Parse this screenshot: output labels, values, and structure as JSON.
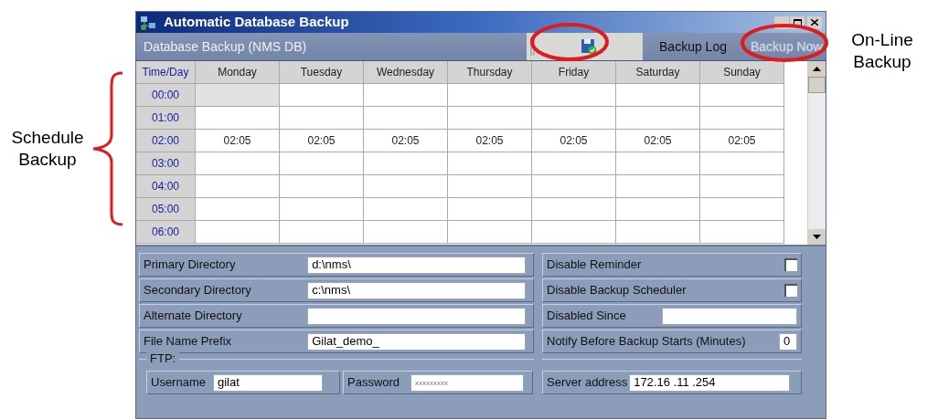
{
  "annotations": {
    "left": "Schedule Backup",
    "right": "On-Line Backup"
  },
  "window": {
    "title": "Automatic Database Backup"
  },
  "toolbar": {
    "title": "Database Backup (NMS DB)",
    "buttons": [
      {
        "kind": "icon",
        "disabled": false
      },
      {
        "kind": "text",
        "label": "Backup Log",
        "disabled": false
      },
      {
        "kind": "text",
        "label": "Backup Now",
        "disabled": true
      }
    ]
  },
  "schedule": {
    "corner": "Time/Day",
    "days": [
      "Monday",
      "Tuesday",
      "Wednesday",
      "Thursday",
      "Friday",
      "Saturday",
      "Sunday"
    ],
    "rows": [
      {
        "time": "00:00",
        "cells": [
          {
            "selected": true
          },
          {
            "selected": false
          },
          {
            "selected": false
          },
          {
            "selected": false
          },
          {
            "selected": false
          },
          {
            "selected": false
          },
          {
            "selected": false
          }
        ]
      },
      {
        "time": "01:00",
        "cells": [
          {
            "selected": false
          },
          {
            "selected": false
          },
          {
            "selected": false
          },
          {
            "selected": false
          },
          {
            "selected": false
          },
          {
            "selected": false
          },
          {
            "selected": false
          }
        ]
      },
      {
        "time": "02:00",
        "cells": [
          {
            "text": "02:05",
            "selected": false
          },
          {
            "text": "02:05",
            "selected": false
          },
          {
            "text": "02:05",
            "selected": false
          },
          {
            "text": "02:05",
            "selected": false
          },
          {
            "text": "02:05",
            "selected": false
          },
          {
            "text": "02:05",
            "selected": false
          },
          {
            "text": "02:05",
            "selected": false
          }
        ]
      },
      {
        "time": "03:00",
        "cells": [
          {
            "selected": false
          },
          {
            "selected": false
          },
          {
            "selected": false
          },
          {
            "selected": false
          },
          {
            "selected": false
          },
          {
            "selected": false
          },
          {
            "selected": false
          }
        ]
      },
      {
        "time": "04:00",
        "cells": [
          {
            "selected": false
          },
          {
            "selected": false
          },
          {
            "selected": false
          },
          {
            "selected": false
          },
          {
            "selected": false
          },
          {
            "selected": false
          },
          {
            "selected": false
          }
        ]
      },
      {
        "time": "05:00",
        "cells": [
          {
            "selected": false
          },
          {
            "selected": false
          },
          {
            "selected": false
          },
          {
            "selected": false
          },
          {
            "selected": false
          },
          {
            "selected": false
          },
          {
            "selected": false
          }
        ]
      },
      {
        "time": "06:00",
        "cells": [
          {
            "selected": false
          },
          {
            "selected": false
          },
          {
            "selected": false
          },
          {
            "selected": false
          },
          {
            "selected": false
          },
          {
            "selected": false
          },
          {
            "selected": false
          }
        ]
      }
    ]
  },
  "directories": [
    {
      "label": "Primary Directory",
      "value": "d:\\nms\\"
    },
    {
      "label": "Secondary Directory",
      "value": "c:\\nms\\"
    },
    {
      "label": "Alternate Directory"
    },
    {
      "label": "File Name Prefix",
      "value": "Gilat_demo_"
    }
  ],
  "options": [
    {
      "kind": "checkbox",
      "label": "Disable Reminder",
      "checked": false
    },
    {
      "kind": "checkbox",
      "label": "Disable Backup Scheduler",
      "checked": false
    },
    {
      "kind": "field",
      "label": "Disabled Since"
    },
    {
      "kind": "number",
      "label": "Notify Before Backup Starts (Minutes)",
      "value": "0"
    }
  ],
  "ftp": {
    "legend": "FTP:",
    "username": {
      "label": "Username",
      "value": "gilat"
    },
    "password": {
      "label": "Password",
      "value": "xxxxxxxxx"
    },
    "server": {
      "label": "Server address",
      "value": "172.16 .11 .254"
    }
  }
}
